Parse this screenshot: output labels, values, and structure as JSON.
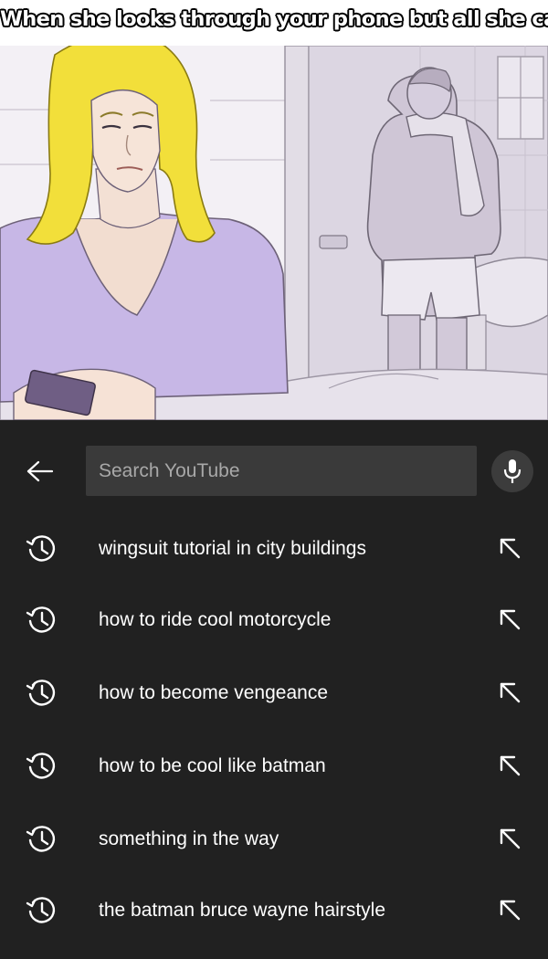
{
  "meme": {
    "caption": "When she looks through your phone but all she can find is"
  },
  "search": {
    "placeholder": "Search YouTube",
    "back_icon": "arrow-left-icon",
    "mic_icon": "microphone-icon"
  },
  "history": [
    {
      "text": "wingsuit tutorial in city buildings",
      "icon": "history-icon",
      "action_icon": "arrow-up-left-icon"
    },
    {
      "text": "how to ride cool motorcycle",
      "icon": "history-icon",
      "action_icon": "arrow-up-left-icon"
    },
    {
      "text": "how to become vengeance",
      "icon": "history-icon",
      "action_icon": "arrow-up-left-icon"
    },
    {
      "text": "how to be cool like batman",
      "icon": "history-icon",
      "action_icon": "arrow-up-left-icon"
    },
    {
      "text": "something in the way",
      "icon": "history-icon",
      "action_icon": "arrow-up-left-icon"
    },
    {
      "text": "the batman bruce wayne hairstyle",
      "icon": "history-icon",
      "action_icon": "arrow-up-left-icon"
    }
  ],
  "colors": {
    "background": "#212121",
    "search_field": "#3a3a3a",
    "text": "#ffffff",
    "placeholder": "#a8a8a8"
  }
}
